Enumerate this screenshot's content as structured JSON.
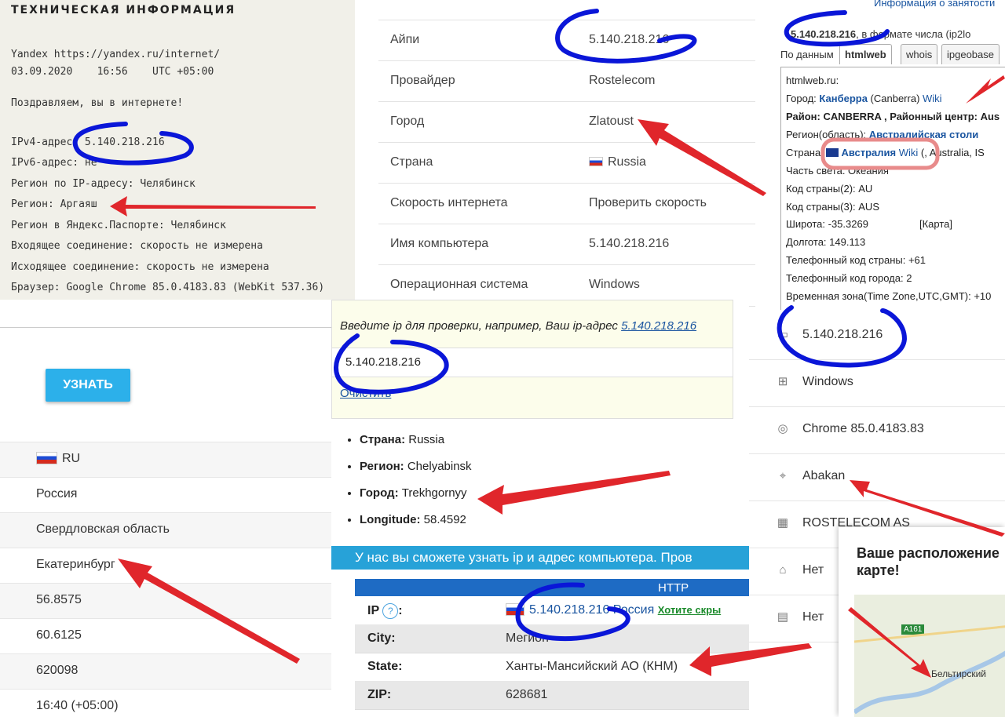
{
  "yandex": {
    "title": "ТЕХНИЧЕСКАЯ ИНФОРМАЦИЯ",
    "line1": "Yandex https://yandex.ru/internet/",
    "line2": "03.09.2020    16:56    UTC +05:00",
    "line3": "Поздравляем, вы в интернете!",
    "ipv4": "IPv4-адрес: 5.140.218.216",
    "ipv6": "IPv6-адрес: не ",
    "region_ip": "Регион по IP-адресу: Челябинск",
    "region": "Регион: Аргаяш",
    "region_passport": "Регион в Яндекс.Паспорте: Челябинск",
    "incoming": "Входящее соединение: скорость не измерена",
    "outgoing": "Исходящее соединение: скорость не измерена",
    "browser": "Браузер: Google Chrome 85.0.4183.83 (WebKit 537.36)"
  },
  "table_b": {
    "rows": [
      {
        "k": "Айпи",
        "v": "5.140.218.216"
      },
      {
        "k": "Провайдер",
        "v": "Rostelecom"
      },
      {
        "k": "Город",
        "v": "Zlatoust"
      },
      {
        "k": "Страна",
        "v": "Russia"
      },
      {
        "k": "Скорость интернета",
        "v": "Проверить скорость"
      },
      {
        "k": "Имя компьютера",
        "v": "5.140.218.216"
      },
      {
        "k": "Операционная система",
        "v": "Windows"
      }
    ]
  },
  "htmlweb": {
    "top_link": "Информация о занятости",
    "ip_line_ip": "5.140.218.216",
    "ip_line_rest": ", в формате числа (ip2lo",
    "tabs": [
      "По данным",
      "htmlweb",
      "whois",
      "ipgeobase"
    ],
    "site": "htmlweb.ru:",
    "city_label": "Город: ",
    "city": "Канберра",
    "city_en": " (Canberra) ",
    "wiki": "Wiki",
    "district": "Район: CANBERRA , Районный центр: Aus",
    "region_label": "Регион(область): ",
    "region": "Австралийская столи",
    "country_label": "Страна: ",
    "country": "Австралия",
    "country_wiki": "Wiki",
    "country_rest": " (, Australia, IS",
    "continent": "Часть света: Океания",
    "code2": "Код страны(2): AU",
    "code3": "Код страны(3): AUS",
    "lat": "Широта: -35.3269",
    "map": "[Карта]",
    "lon": "Долгота: 149.113",
    "phone_country": "Телефонный код страны: +61",
    "phone_city": "Телефонный код города: 2",
    "tz": "Временная зона(Time Zone,UTC,GMT): +10"
  },
  "left_bottom": {
    "button": "УЗНАТЬ",
    "rows": [
      "RU",
      "Россия",
      "Свердловская область",
      "Екатеринбург",
      "56.8575",
      "60.6125",
      "620098",
      "16:40 (+05:00)"
    ]
  },
  "center": {
    "prompt": "Введите ip для проверки, например, Ваш ip-адрес ",
    "prompt_ip": "5.140.218.216",
    "input_value": "5.140.218.216",
    "clear": "Очистить",
    "items": [
      {
        "k": "Страна:",
        "v": " Russia"
      },
      {
        "k": "Регион:",
        "v": " Chelyabinsk"
      },
      {
        "k": "Город:",
        "v": " Trekhgornyy"
      },
      {
        "k": "Longitude:",
        "v": " 58.4592"
      }
    ],
    "banner": "У нас вы сможете узнать ip и адрес компьютера. Пров",
    "table_header": "HTTP",
    "ip_label": "IP",
    "ip_q": "?",
    "ip_colon": ":",
    "ip_value": "5.140.218.216",
    "ip_country": " Россия",
    "ip_hide": "Хотите скры",
    "rows": [
      {
        "k": "City:",
        "v": "Мегион"
      },
      {
        "k": "State:",
        "v": "Ханты-Мансийский АО (КНМ)"
      },
      {
        "k": "ZIP:",
        "v": "628681"
      }
    ]
  },
  "right_list": {
    "items": [
      {
        "icon": "monitor-icon",
        "text": "5.140.218.216"
      },
      {
        "icon": "windows-icon",
        "text": "Windows"
      },
      {
        "icon": "chrome-icon",
        "text": "Chrome 85.0.4183.83"
      },
      {
        "icon": "location-pin-icon",
        "text": "Abakan"
      },
      {
        "icon": "building-icon",
        "text": "ROSTELECOM AS"
      },
      {
        "icon": "network-icon",
        "text": "Нет"
      },
      {
        "icon": "server-icon",
        "text": "Нет"
      }
    ]
  },
  "map_card": {
    "title": "Ваше расположение карте!",
    "road": "A161",
    "place": "Бельтирский"
  },
  "colors": {
    "annotation_blue": "#0a16d8",
    "arrow_red": "#e0262b",
    "accent": "#27a2d8"
  }
}
